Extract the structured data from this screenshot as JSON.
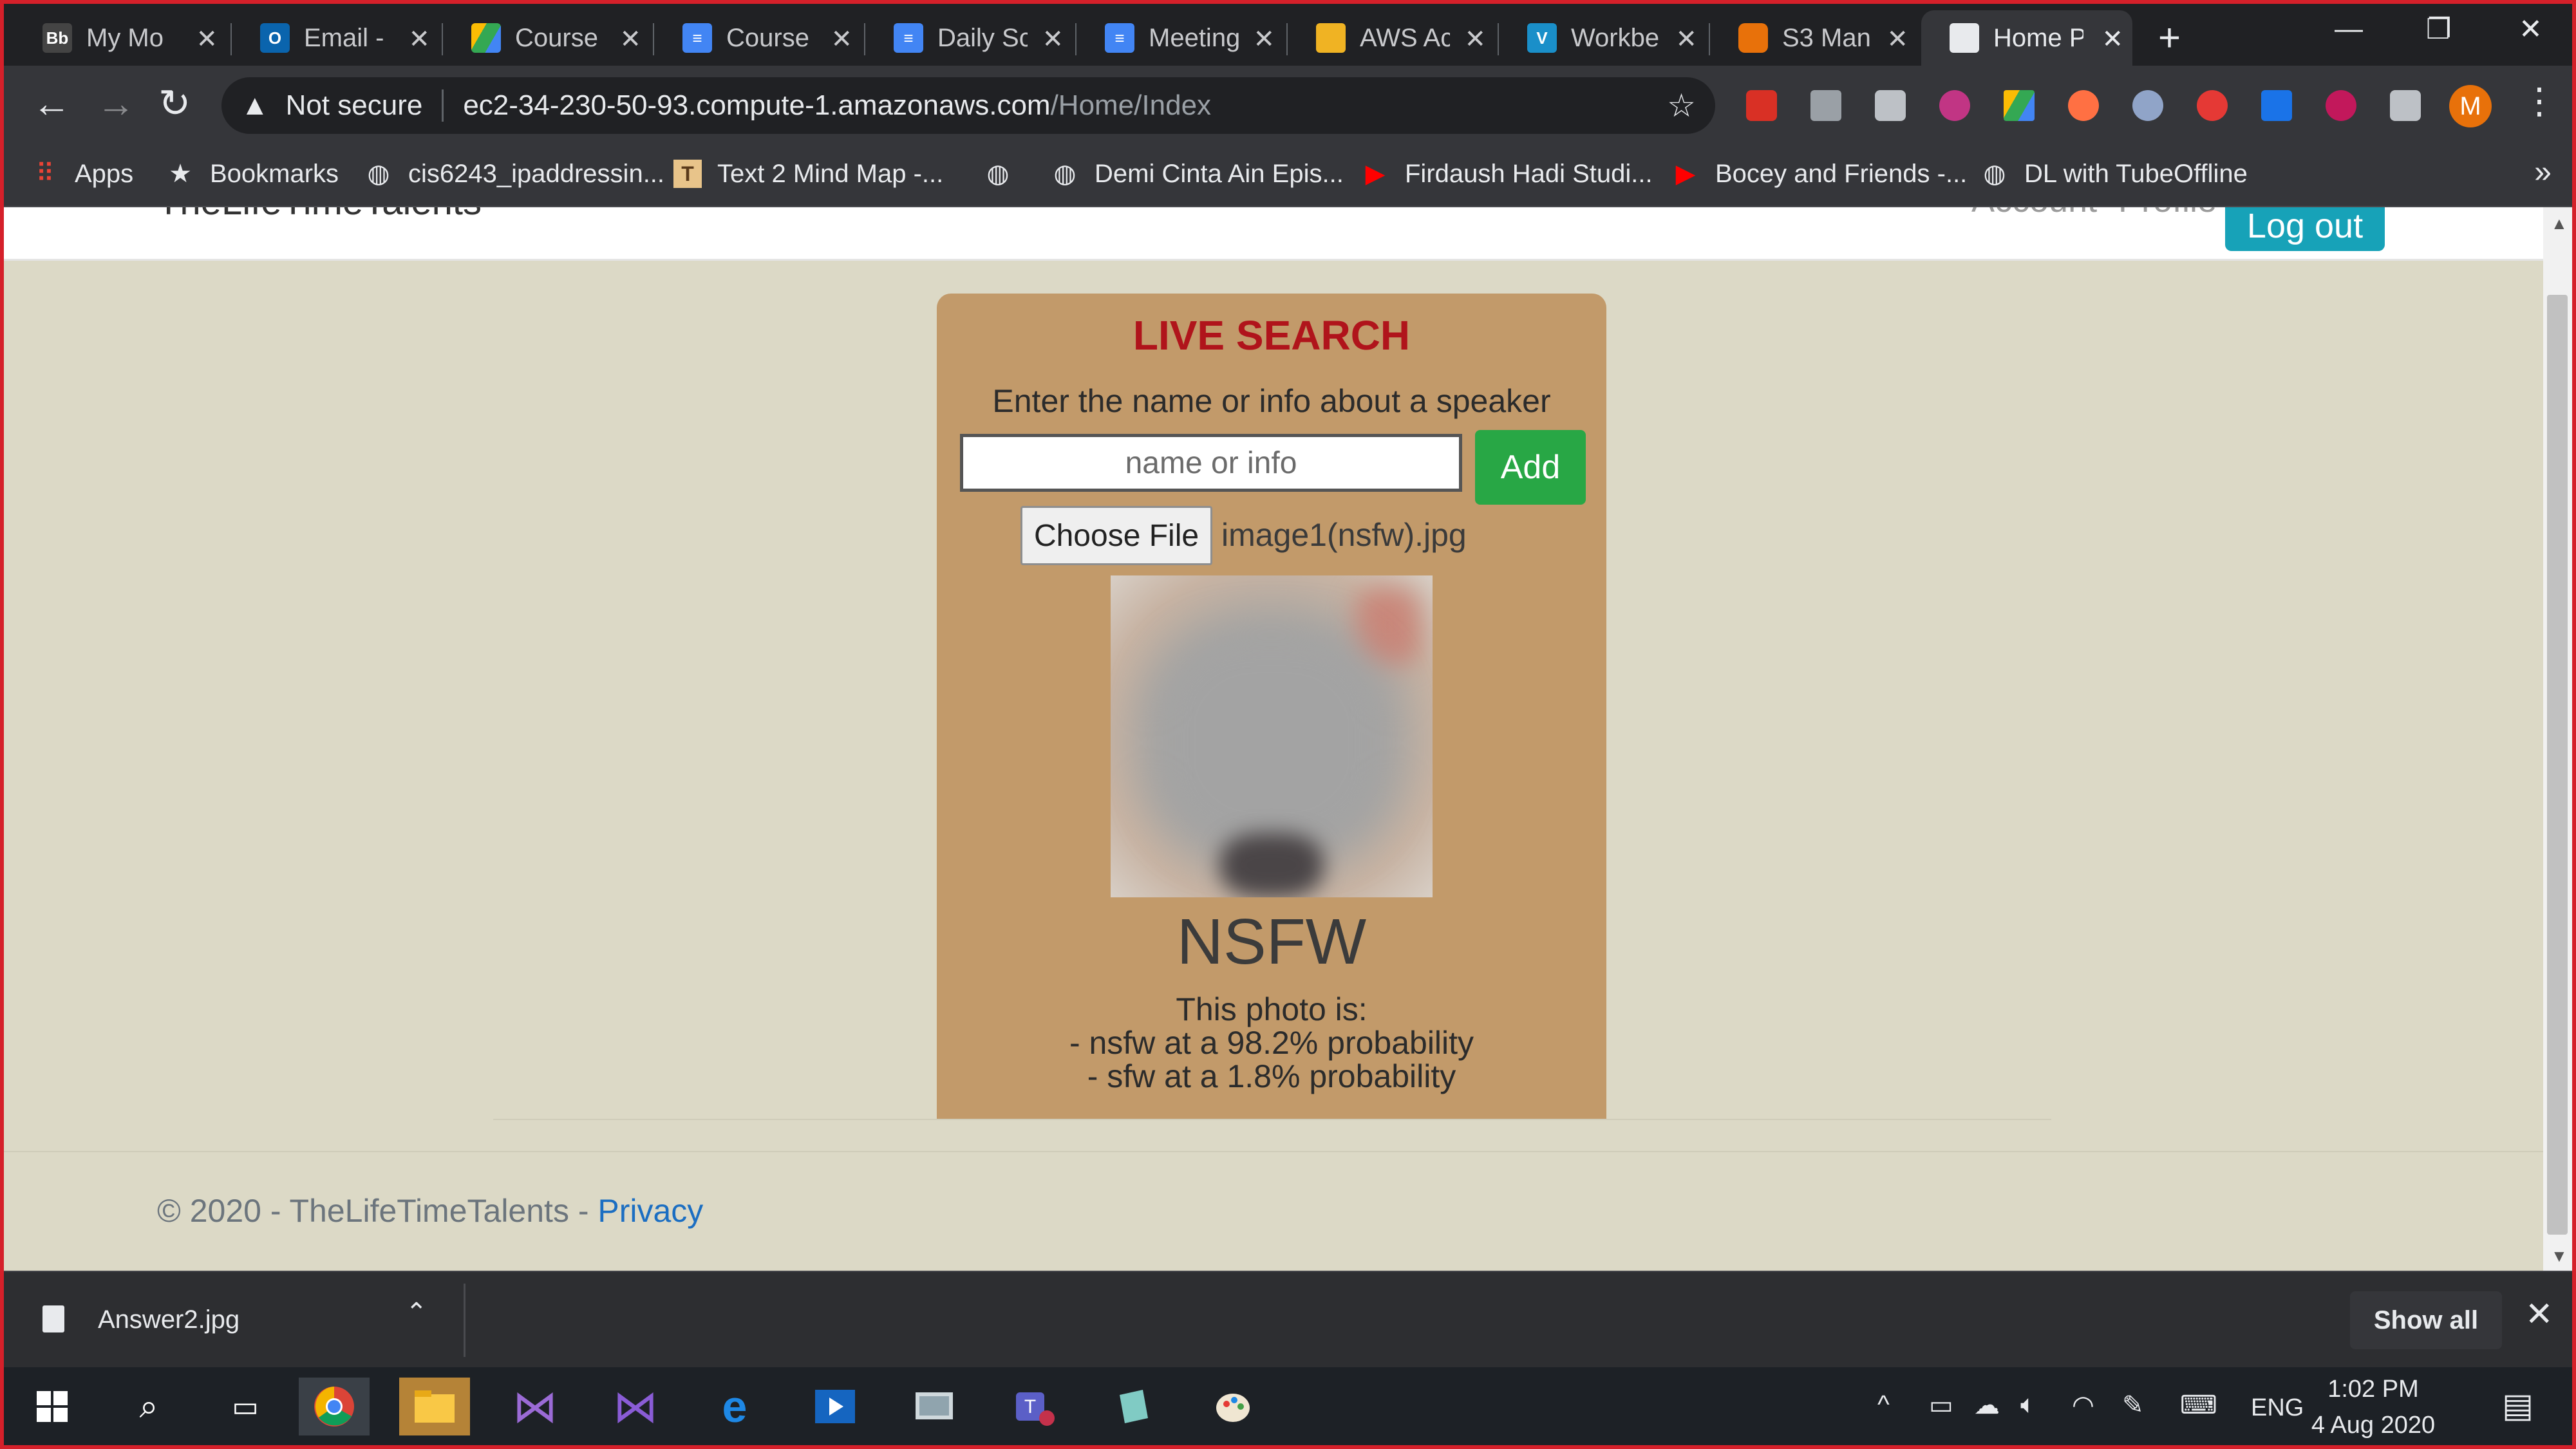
{
  "browser": {
    "tabs": [
      {
        "title": "My Mo",
        "icon": "blackboard-icon"
      },
      {
        "title": "Email -",
        "icon": "outlook-icon"
      },
      {
        "title": "Course",
        "icon": "google-drive-icon"
      },
      {
        "title": "Course",
        "icon": "google-docs-icon"
      },
      {
        "title": "Daily Sc",
        "icon": "google-docs-icon"
      },
      {
        "title": "Meeting",
        "icon": "google-docs-icon"
      },
      {
        "title": "AWS Ac",
        "icon": "aws-box-icon"
      },
      {
        "title": "Workbe",
        "icon": "vocareum-icon"
      },
      {
        "title": "S3 Man",
        "icon": "s3-icon"
      },
      {
        "title": "Home P",
        "icon": "page-icon"
      }
    ],
    "omnibox": {
      "security_label": "Not secure",
      "url_host": "ec2-34-230-50-93.compute-1.amazonaws.com",
      "url_path": "/Home/Index"
    },
    "profile_initial": "M",
    "bookmarks": [
      {
        "label": "Apps",
        "icon": "apps-grid-icon"
      },
      {
        "label": "Bookmarks",
        "icon": "star-icon"
      },
      {
        "label": "cis6243_ipaddressin...",
        "icon": "globe-icon"
      },
      {
        "label": "Text 2 Mind Map -...",
        "icon": "t-logo-icon"
      },
      {
        "label": "",
        "icon": "globe-icon"
      },
      {
        "label": "Demi Cinta Ain Epis...",
        "icon": "globe-icon"
      },
      {
        "label": "Firdaush Hadi Studi...",
        "icon": "youtube-icon"
      },
      {
        "label": "Bocey and Friends -...",
        "icon": "youtube-icon"
      },
      {
        "label": "DL with TubeOffline",
        "icon": "globe-icon"
      }
    ],
    "bookmarks_more": "»"
  },
  "site": {
    "brand": "TheLifeTimeTalents",
    "nav": [
      "Account",
      "Profile"
    ],
    "logout_label": "Log out",
    "card": {
      "title": "LIVE SEARCH",
      "instruction": "Enter the name or info about a speaker",
      "search_placeholder": "name or info",
      "add_label": "Add",
      "choose_file_label": "Choose File",
      "file_name": "image1(nsfw).jpg",
      "verdict": "NSFW",
      "result_intro": "This photo is:",
      "result_lines": [
        "- nsfw at a 98.2% probability",
        "- sfw at a 1.8% probability"
      ]
    },
    "footer": {
      "text": "© 2020 - TheLifeTimeTalents - ",
      "privacy": "Privacy"
    }
  },
  "downloads": {
    "file": "Answer2.jpg",
    "show_all": "Show all"
  },
  "taskbar": {
    "language": "ENG",
    "time": "1:02 PM",
    "date": "4 Aug 2020"
  }
}
